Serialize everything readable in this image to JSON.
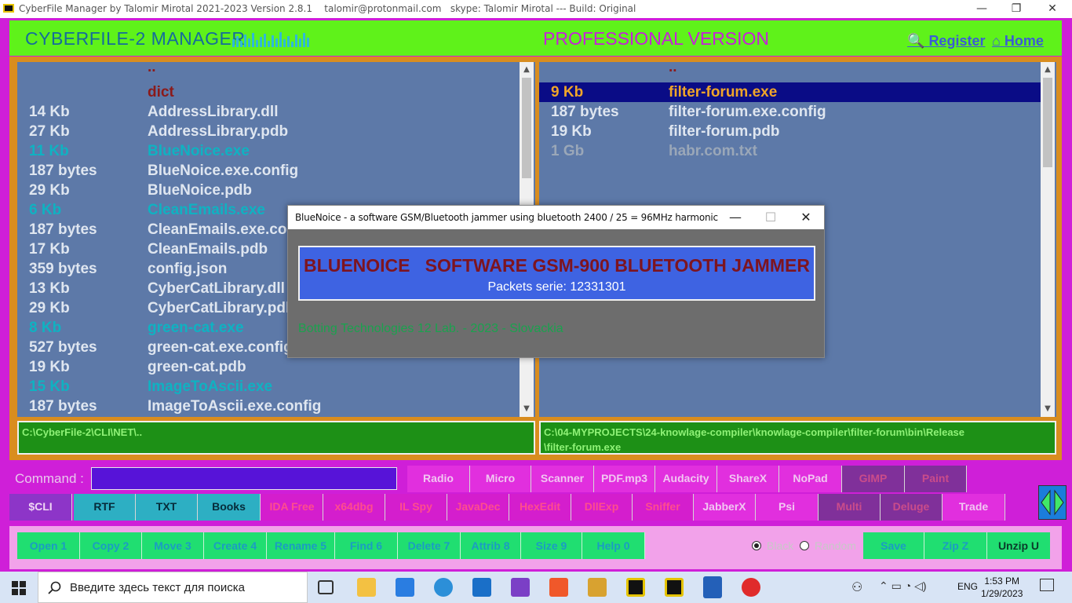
{
  "window": {
    "title": "CyberFile Manager by Talomir Mirotal 2021-2023 Version 2.8.1    talomir@protonmail.com   skype: Talomir Mirotal --- Build: Original",
    "minimize": "—",
    "restore": "❐",
    "close": "✕"
  },
  "header": {
    "app_title": "CYBERFILE-2 MANAGER",
    "edition": "PROFESSIONAL VERSION",
    "register": "Register",
    "home": "Home",
    "accent": "#5ff21a"
  },
  "left_panel": {
    "rows": [
      {
        "size": "",
        "name": "..",
        "kind": "dir"
      },
      {
        "size": "",
        "name": "dict",
        "kind": "dir"
      },
      {
        "size": "14 Kb",
        "name": "AddressLibrary.dll",
        "kind": "file"
      },
      {
        "size": "27 Kb",
        "name": "AddressLibrary.pdb",
        "kind": "file"
      },
      {
        "size": "11 Kb",
        "name": "BlueNoice.exe",
        "kind": "exe"
      },
      {
        "size": "187  bytes",
        "name": "BlueNoice.exe.config",
        "kind": "file"
      },
      {
        "size": "29 Kb",
        "name": "BlueNoice.pdb",
        "kind": "file"
      },
      {
        "size": "6 Kb",
        "name": "CleanEmails.exe",
        "kind": "exe"
      },
      {
        "size": "187  bytes",
        "name": "CleanEmails.exe.con",
        "kind": "file"
      },
      {
        "size": "17 Kb",
        "name": "CleanEmails.pdb",
        "kind": "file"
      },
      {
        "size": "359  bytes",
        "name": "config.json",
        "kind": "file"
      },
      {
        "size": "13 Kb",
        "name": "CyberCatLibrary.dll",
        "kind": "file"
      },
      {
        "size": "29 Kb",
        "name": "CyberCatLibrary.pdb",
        "kind": "file"
      },
      {
        "size": "8 Kb",
        "name": "green-cat.exe",
        "kind": "exe"
      },
      {
        "size": "527  bytes",
        "name": "green-cat.exe.config",
        "kind": "file"
      },
      {
        "size": "19 Kb",
        "name": "green-cat.pdb",
        "kind": "file"
      },
      {
        "size": "15 Kb",
        "name": "ImageToAscii.exe",
        "kind": "exe"
      },
      {
        "size": "187  bytes",
        "name": "ImageToAscii.exe.config",
        "kind": "file"
      }
    ],
    "path": "C:\\CyberFile-2\\CLI\\NET\\.."
  },
  "right_panel": {
    "rows": [
      {
        "size": "",
        "name": "..",
        "kind": "dir"
      },
      {
        "size": "9 Kb",
        "name": "filter-forum.exe",
        "kind": "selected"
      },
      {
        "size": "187  bytes",
        "name": "filter-forum.exe.config",
        "kind": "file"
      },
      {
        "size": "19 Kb",
        "name": "filter-forum.pdb",
        "kind": "file"
      },
      {
        "size": "1 Gb",
        "name": "habr.com.txt",
        "kind": "grey"
      }
    ],
    "path_line1": "C:\\04-MYPROJECTS\\24-knowlage-compiler\\knowlage-compiler\\filter-forum\\bin\\Release",
    "path_line2": "\\filter-forum.exe"
  },
  "command": {
    "label": "Command :",
    "value": ""
  },
  "tools_row1": [
    "Radio",
    "Micro",
    "Scanner",
    "PDF.mp3",
    "Audacity",
    "ShareX",
    "NoPad",
    "GIMP",
    "Paint"
  ],
  "tools_row2": [
    "$CLI",
    "RTF",
    "TXT",
    "Books",
    "IDA Free",
    "x64dbg",
    "IL Spy",
    "JavaDec",
    "HexEdit",
    "DllExp",
    "Sniffer",
    "JabberX",
    "Psi",
    "Multi",
    "Deluge",
    "Trade"
  ],
  "function_keys": [
    "Open 1",
    "Copy 2",
    "Move 3",
    "Create 4",
    "Rename 5",
    "Find 6",
    "Delete 7",
    "Attrib 8",
    "Size 9",
    "Help 0"
  ],
  "theme": {
    "black": "Black",
    "random": "Random",
    "selected": "Black"
  },
  "archive_buttons": [
    "Save",
    "Zip Z",
    "Unzip U"
  ],
  "dialog": {
    "title": "BlueNoice - a software GSM/Bluetooth jammer using bluetooth 2400 / 25 = 96MHz harmonic",
    "heading": "BLUENOICE   SOFTWARE GSM-900 BLUETOOTH JAMMER",
    "packets": "Packets serie: 12331301",
    "footer": "Botting Technologies 12 Lab. - 2023 - Slovackia"
  },
  "taskbar": {
    "search_placeholder": "Введите здесь текст для поиска",
    "lang": "ENG",
    "time": "1:53 PM",
    "date": "1/29/2023"
  }
}
